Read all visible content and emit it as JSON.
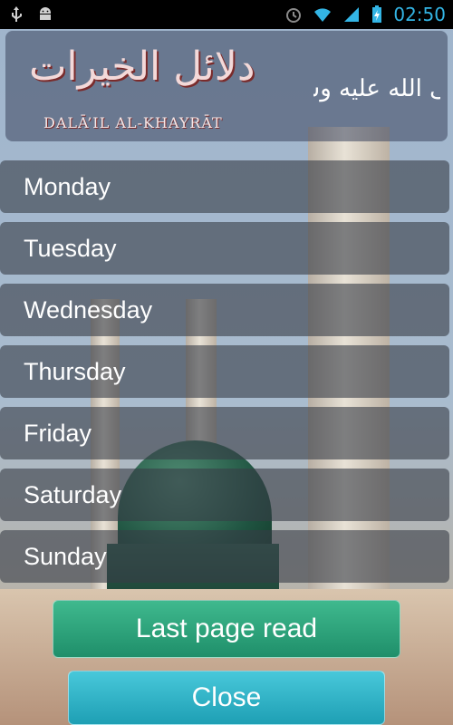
{
  "statusbar": {
    "left_icons": [
      "usb-icon",
      "android-icon"
    ],
    "right_icons": [
      "alarm-icon",
      "wifi-icon",
      "signal-icon",
      "battery-charging-icon"
    ],
    "time": "02:50",
    "icon_color": "#33b5e5"
  },
  "header": {
    "title_arabic": "دلائل الخيرات",
    "title_english": "DALĀ’IL AL-KHAYRĀT",
    "calligraphy": "صلى الله عليه وسلم"
  },
  "days": [
    "Monday",
    "Tuesday",
    "Wednesday",
    "Thursday",
    "Friday",
    "Saturday",
    "Sunday"
  ],
  "buttons": {
    "last_page": "Last page read",
    "close": "Close"
  },
  "colors": {
    "last_page_button": "#2aa57b",
    "close_button": "#2fb3c8"
  }
}
